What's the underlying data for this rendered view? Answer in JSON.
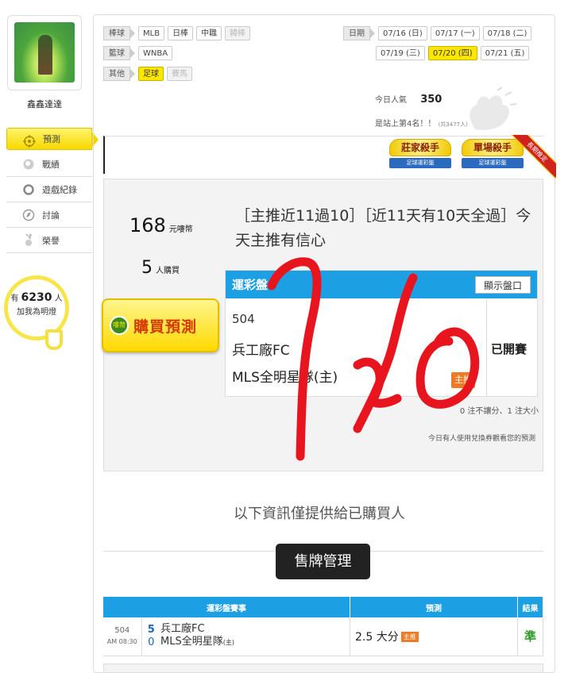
{
  "user": {
    "name": "鑫鑫達達"
  },
  "sidebar": {
    "items": [
      {
        "label": "預測",
        "icon": "target-icon",
        "active": true
      },
      {
        "label": "戰績",
        "icon": "chat-bubble-icon",
        "active": false
      },
      {
        "label": "遊戲紀錄",
        "icon": "circle-icon",
        "active": false
      },
      {
        "label": "討論",
        "icon": "compass-icon",
        "active": false
      },
      {
        "label": "榮譽",
        "icon": "medal-icon",
        "active": false
      }
    ]
  },
  "bulb": {
    "prefix": "有",
    "count": "6230",
    "unit": "人",
    "caption": "加我為明燈"
  },
  "filters": {
    "baseball": {
      "category": "棒球",
      "items": [
        "MLB",
        "日棒",
        "中職",
        "韓棒"
      ]
    },
    "basketball": {
      "category": "籃球",
      "items": [
        "WNBA"
      ]
    },
    "other": {
      "category": "其他",
      "items": [
        "足球",
        "賽馬"
      ]
    },
    "date": {
      "category": "日期",
      "items": [
        "07/16 (日)",
        "07/17 (一)",
        "07/18 (二)",
        "07/19 (三)",
        "07/20 (四)",
        "07/21 (五)"
      ]
    }
  },
  "stats": {
    "popularity_label": "今日人氣",
    "popularity_value": "350",
    "rank_text": "是站上第4名！！",
    "rank_total": "(共3477人)"
  },
  "badges": {
    "banker": {
      "title": "莊家殺手",
      "sub": "足球運彩盤"
    },
    "single": {
      "title": "單場殺手",
      "sub": "足球運彩盤"
    },
    "corner": "長期推定"
  },
  "offer": {
    "price": "168",
    "price_unit": "元嘍幣",
    "buyers": "5",
    "buyers_unit": "人購買",
    "buy_label": "購買預測",
    "coin_label": "嘍幣"
  },
  "prediction": {
    "headline": "［主推近11過10］［近11天有10天全過］今天主推有信心"
  },
  "lottery": {
    "title": "運彩盤",
    "show_button": "顯示盤口",
    "game_no": "504",
    "team_away": "兵工廠FC",
    "team_home": "MLS全明星隊(主)",
    "host_tag": "主推",
    "status": "已開賽",
    "summary": "0 注不讓分、1 注大小",
    "voucher_note": "今日有人使用兌換券觀看您的預測"
  },
  "info_note": "以下資訊僅提供給已購買人",
  "ticket_button": "售牌管理",
  "results": {
    "headers": [
      "運彩盤賽事",
      "預測",
      "結果"
    ],
    "rows": [
      {
        "game_no": "504",
        "time": "AM 08:30",
        "score_away": "5",
        "score_home": "0",
        "team_away": "兵工廠FC",
        "team_home": "MLS全明星隊",
        "home_mark": "(主)",
        "pick": "2.5 大分",
        "pick_tag": "主推",
        "result": "準"
      }
    ]
  },
  "overlay": {
    "handwritten": "7/20"
  },
  "colors": {
    "accent_blue": "#1c9fe3",
    "highlight_yellow": "#ffe600",
    "host_orange": "#f07a24",
    "win_green": "#2e9a2a",
    "ink_red": "#e8141e"
  }
}
